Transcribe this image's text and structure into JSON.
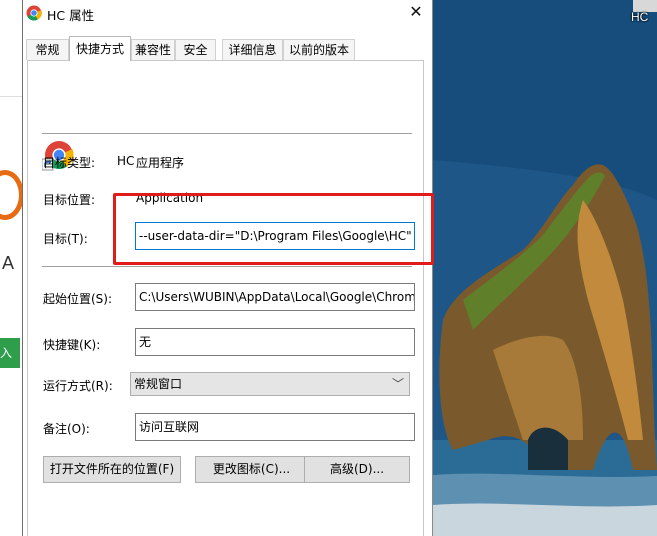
{
  "window": {
    "title": "HC 属性",
    "close_glyph": "✕"
  },
  "tabs": [
    {
      "label": "常规"
    },
    {
      "label": "快捷方式",
      "active": true
    },
    {
      "label": "兼容性"
    },
    {
      "label": "安全"
    },
    {
      "label": "详细信息"
    },
    {
      "label": "以前的版本"
    }
  ],
  "shortcut": {
    "name": "HC",
    "target_type_label": "目标类型:",
    "target_type_value": "应用程序",
    "target_location_label": "目标位置:",
    "target_location_value": "Application",
    "target_label": "目标(T):",
    "target_value": "--user-data-dir=\"D:\\Program Files\\Google\\HC\"",
    "start_in_label": "起始位置(S):",
    "start_in_value": "C:\\Users\\WUBIN\\AppData\\Local\\Google\\Chrome",
    "hotkey_label": "快捷键(K):",
    "hotkey_value": "无",
    "run_label": "运行方式(R):",
    "run_value": "常规窗口",
    "comment_label": "备注(O):",
    "comment_value": "访问互联网"
  },
  "buttons": {
    "open_location": "打开文件所在的位置(F)",
    "change_icon": "更改图标(C)...",
    "advanced": "高级(D)..."
  },
  "desktop": {
    "icon_label": "HC"
  },
  "behind": {
    "letter": "A",
    "green_text": "入"
  },
  "icons": {
    "app": "chrome-icon",
    "close": "close-icon",
    "dropdown": "chevron-down-icon"
  },
  "colors": {
    "highlight": "#e11b1b",
    "focus_border": "#0078d7"
  }
}
